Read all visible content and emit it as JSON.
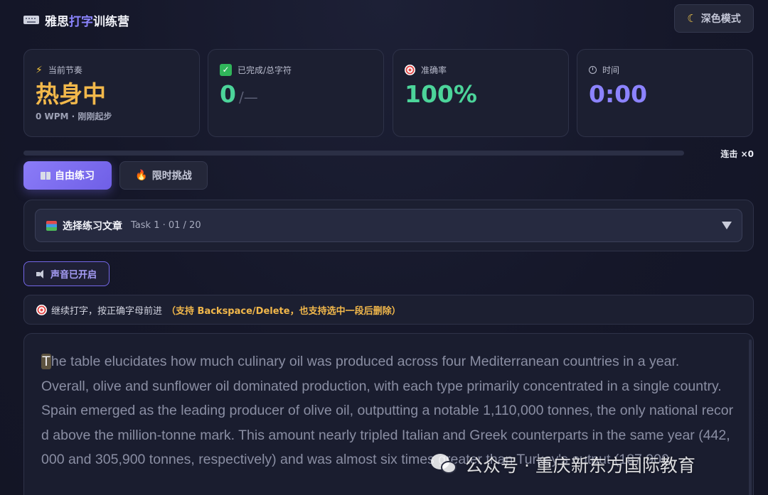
{
  "app": {
    "title_prefix": "雅思",
    "title_accent": "打字",
    "title_suffix": "训练营",
    "theme_button": "深色模式"
  },
  "stats": {
    "rhythm": {
      "label": "当前节奏",
      "value": "热身中",
      "sub": "0 WPM · 刚刚起步"
    },
    "progress": {
      "label": "已完成/总字符",
      "value": "0",
      "total": "/—"
    },
    "accuracy": {
      "label": "准确率",
      "value": "100%"
    },
    "time": {
      "label": "时间",
      "value": "0:00"
    }
  },
  "progress_bar": {
    "fraction": 0.0,
    "combo": "连击 ×0"
  },
  "modes": {
    "free": "自由练习",
    "challenge": "限时挑战",
    "active": "free"
  },
  "article_select": {
    "label": "选择练习文章",
    "selected": "Task 1 · 01 / 20"
  },
  "sound": {
    "label": "声音已开启"
  },
  "hint": {
    "text": "继续打字，按正确字母前进",
    "strong": "（支持 Backspace/Delete，也支持选中一段后删除）"
  },
  "typing": {
    "cursor_char": "T",
    "text": "he table elucidates how much culinary oil was produced across four Mediterranean countries in a year.\nOverall, olive and sunflower oil dominated production, with each type primarily concentrated in a single country.\nSpain emerged as the leading producer of olive oil, outputting a notable 1,110,000 tonnes, the only national record above the million-tonne mark. This amount nearly tripled Italian and Greek counterparts in the same year (442,000 and 305,900 tonnes, respectively) and was almost six times greater than Turkey's output (187,900"
  },
  "watermark": {
    "text": "公众号 · 重庆新东方国际教育"
  },
  "colors": {
    "accent": "#7c6cf5",
    "rhythm": "#f2b84b",
    "accuracy": "#4cd49a",
    "time": "#8c83ff"
  }
}
